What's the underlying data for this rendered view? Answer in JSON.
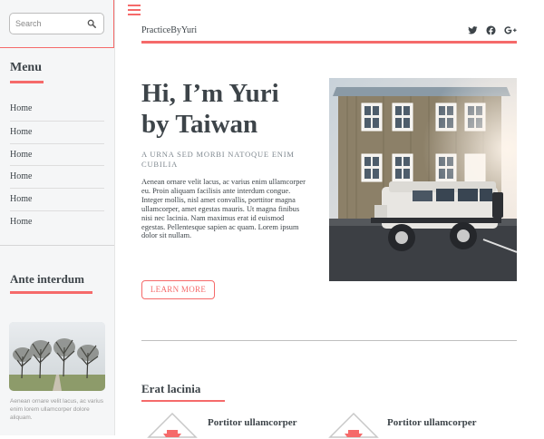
{
  "sidebar": {
    "search": {
      "placeholder": "Search"
    },
    "menu": {
      "heading": "Menu",
      "items": [
        {
          "label": "Home"
        },
        {
          "label": "Home"
        },
        {
          "label": "Home"
        },
        {
          "label": "Home"
        },
        {
          "label": "Home"
        },
        {
          "label": "Home"
        }
      ]
    },
    "aside": {
      "heading": "Ante interdum",
      "caption": "Aenean ornare velit lacus, ac varius enim lorem ullamcorper dolore aliquam."
    }
  },
  "header": {
    "site_title": "PracticeByYuri",
    "socials": [
      "twitter-icon",
      "facebook-icon",
      "google-plus-icon"
    ]
  },
  "hero": {
    "title_line1": "Hi, I’m Yuri",
    "title_line2": "by Taiwan",
    "subtitle": "A URNA SED MORBI NATOQUE ENIM CUBILIA",
    "body": "Aenean ornare velit lacus, ac varius enim ullamcorper eu. Proin aliquam facilisis ante interdum congue. Integer mollis, nisl amet convallis, porttitor magna ullamcorper, amet egestas mauris. Ut magna finibus nisi nec lacinia. Nam maximus erat id euismod egestas. Pellentesque sapien ac quam. Lorem ipsum dolor sit nullam.",
    "button": "LEARN MORE"
  },
  "features": {
    "heading": "Erat lacinia",
    "items": [
      {
        "title": "Portitor ullamcorper"
      },
      {
        "title": "Portitor ullamcorper"
      }
    ]
  },
  "colors": {
    "accent": "#f56a6a",
    "text": "#3d4449",
    "sidebar_bg": "#f5f6f7"
  }
}
